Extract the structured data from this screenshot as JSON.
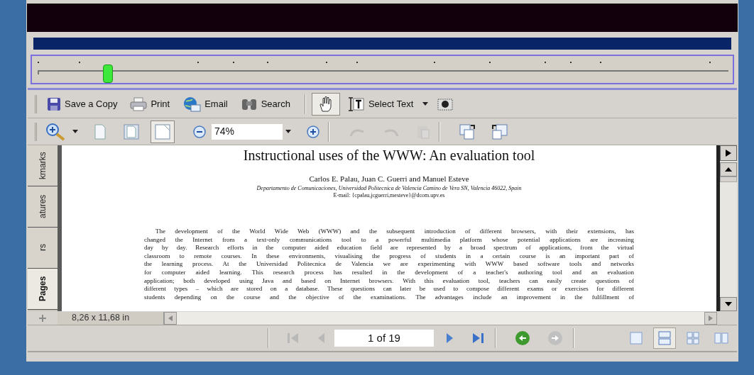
{
  "slider": {
    "level": 0.1
  },
  "file_toolbar": [
    {
      "kind": "save",
      "label": "Save a Copy"
    },
    {
      "kind": "print",
      "label": "Print"
    },
    {
      "kind": "email",
      "label": "Email"
    },
    {
      "kind": "search",
      "label": "Search"
    }
  ],
  "tools": [
    {
      "kind": "hand",
      "selected": true
    },
    {
      "kind": "select_text",
      "label": "Select Text",
      "selected": false
    },
    {
      "kind": "snapshot",
      "selected": false
    }
  ],
  "page_views": [
    {
      "kind": "actual_size",
      "selected": false
    },
    {
      "kind": "fit_page",
      "selected": false
    },
    {
      "kind": "fit_width",
      "selected": true
    }
  ],
  "zoom_field": {
    "value": "74%"
  },
  "edit_buttons": [
    {
      "kind": "undo",
      "disabled": true
    },
    {
      "kind": "redo",
      "disabled": true
    },
    {
      "kind": "paste",
      "disabled": true
    }
  ],
  "rotate_buttons": [
    {
      "kind": "rotate_right"
    },
    {
      "kind": "rotate_left"
    }
  ],
  "side_tabs": [
    {
      "label": "Pages",
      "selected": true
    },
    {
      "label": "rs",
      "selected": false
    },
    {
      "label": "atures",
      "selected": false
    },
    {
      "label": "kmarks",
      "selected": false
    }
  ],
  "document": {
    "title": "Instructional uses of the WWW: An evaluation tool",
    "authors": "Carlos E. Palau, Juan C. Guerri and Manuel Esteve",
    "affiliation": "Departamento de Comunicaciones, Universidad Politecnica de Valencia Camino de Vera SN, Valencia 46022, Spain",
    "email": "E-mail: {cpalau,jcguerri,mesteve}@dcom.upv.es",
    "lines": [
      "The development of the World Wide Web (WWW) and the subsequent introduction of different browsers, with their extensions, has",
      "changed the Internet from a text-only communications tool to a powerful multimedia platform whose potential applications are increasing",
      "day by day. Research efforts in the computer aided education field are represented by a broad spectrum of applications, from the virtual",
      "classroom to remote courses. In these environments, visualising the progress of students in a certain course is an important part of",
      "the learning process. At the Universidad Politecnica de Valencia we are experimenting with WWW based software tools and networks",
      "for computer aided learning. This research process has resulted in the development of a teacher's authoring tool and an evaluation",
      "application; both developed using Java and based on Internet browsers. With this evaluation tool, teachers can easily create questions of",
      "different types – which are stored on a database. These questions can later be used to compose different exams or exercises for different",
      "students depending on the course and the objective of the examinations. The advantages include an improvement in the fulfillment of"
    ]
  },
  "page_size": "8,26 x 11,68 in",
  "navigation": {
    "page_field": "1 of 19",
    "page_buttons": [
      {
        "kind": "first",
        "disabled": true
      },
      {
        "kind": "previous",
        "disabled": true
      },
      {
        "kind": "next",
        "disabled": false
      },
      {
        "kind": "last",
        "disabled": false
      }
    ],
    "history_buttons": [
      {
        "kind": "back",
        "disabled": false
      },
      {
        "kind": "forward",
        "disabled": true
      }
    ],
    "layouts": [
      {
        "kind": "single_page",
        "selected": false
      },
      {
        "kind": "continuous",
        "selected": true
      },
      {
        "kind": "continuous_facing",
        "selected": false
      },
      {
        "kind": "facing",
        "selected": false
      }
    ]
  }
}
